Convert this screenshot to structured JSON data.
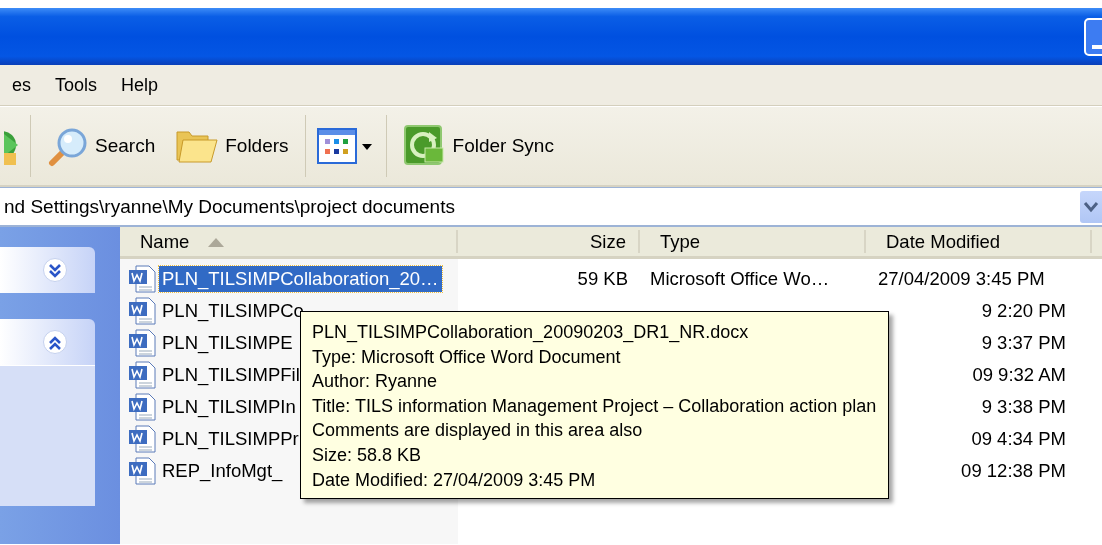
{
  "menu": [
    {
      "label": "es"
    },
    {
      "label": "Tools"
    },
    {
      "label": "Help"
    }
  ],
  "toolbar": [
    {
      "kind": "back"
    },
    {
      "kind": "separator"
    },
    {
      "kind": "search",
      "label": "Search"
    },
    {
      "kind": "folders",
      "label": "Folders"
    },
    {
      "kind": "separator"
    },
    {
      "kind": "views"
    },
    {
      "kind": "separator"
    },
    {
      "kind": "sync",
      "label": "Folder Sync"
    }
  ],
  "address": {
    "value": "nd Settings\\ryanne\\My Documents\\project documents"
  },
  "task_pane": {
    "panels": [
      {
        "expanded": false
      },
      {
        "expanded": true
      }
    ]
  },
  "file_list": {
    "columns": [
      {
        "label": "Name",
        "sorted": true
      },
      {
        "label": "Size",
        "sorted": false
      },
      {
        "label": "Type",
        "sorted": false
      },
      {
        "label": "Date Modified",
        "sorted": false
      }
    ],
    "rows": [
      {
        "name": "PLN_TILSIMPCollaboration_20…",
        "size": "59 KB",
        "type": "Microsoft Office Wo…",
        "modified": "27/04/2009 3:45 PM",
        "selected": true
      },
      {
        "name": "PLN_TILSIMPCo",
        "modified": "9 2:20 PM",
        "selected": false
      },
      {
        "name": "PLN_TILSIMPE",
        "modified": "9 3:37 PM",
        "selected": false
      },
      {
        "name": "PLN_TILSIMPFil",
        "modified": "09 9:32 AM",
        "selected": false
      },
      {
        "name": "PLN_TILSIMPIn",
        "modified": "9 3:38 PM",
        "selected": false
      },
      {
        "name": "PLN_TILSIMPPr",
        "modified": "09 4:34 PM",
        "selected": false
      },
      {
        "name": "REP_InfoMgt_",
        "modified": "09 12:38 PM",
        "selected": false
      }
    ]
  },
  "tooltip": {
    "lines": [
      "PLN_TILSIMPCollaboration_20090203_DR1_NR.docx",
      "Type: Microsoft Office Word Document",
      "Author: Ryanne",
      "Title: TILS information Management Project – Collaboration action plan",
      "Comments are displayed in this area also",
      "Size: 58.8 KB",
      "Date Modified: 27/04/2009 3:45 PM"
    ]
  }
}
